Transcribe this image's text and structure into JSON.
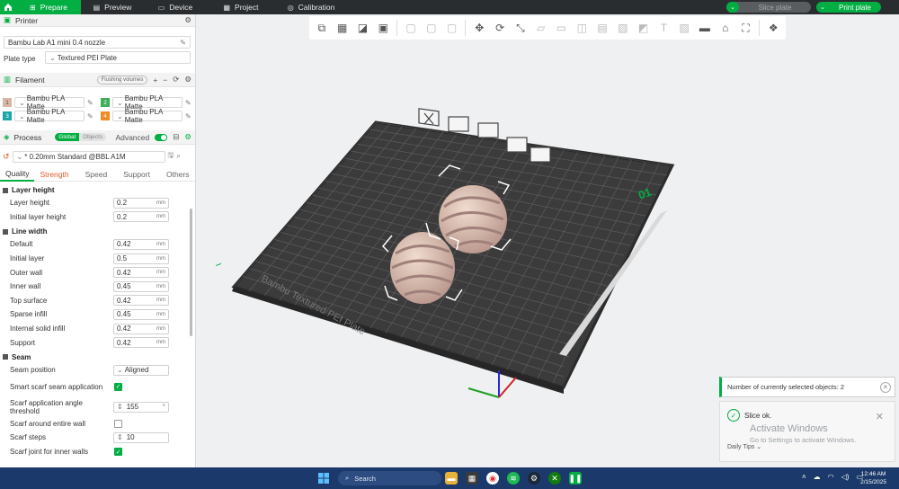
{
  "topbar": {
    "tabs": [
      {
        "label": "Prepare",
        "icon": "prepare-icon"
      },
      {
        "label": "Preview",
        "icon": "preview-icon"
      },
      {
        "label": "Device",
        "icon": "device-icon"
      },
      {
        "label": "Project",
        "icon": "project-icon"
      },
      {
        "label": "Calibration",
        "icon": "calibration-icon"
      }
    ],
    "slice_label": "Slice plate",
    "print_label": "Print plate",
    "accent": "#00ae42"
  },
  "printer": {
    "title": "Printer",
    "name": "Bambu Lab A1 mini 0.4 nozzle",
    "plate_type_label": "Plate type",
    "plate_type": "Textured PEI Plate"
  },
  "filament": {
    "title": "Filament",
    "flushing_label": "Flushing volumes",
    "items": [
      {
        "num": "1",
        "name": "Bambu PLA Matte",
        "color": "#d9b7a6"
      },
      {
        "num": "2",
        "name": "Bambu PLA Matte",
        "color": "#3fae5a"
      },
      {
        "num": "3",
        "name": "Bambu PLA Matte",
        "color": "#1ba7a7"
      },
      {
        "num": "4",
        "name": "Bambu PLA Matte",
        "color": "#f08a24"
      }
    ]
  },
  "process": {
    "title": "Process",
    "global_label": "Global",
    "objects_label": "Objects",
    "advanced_label": "Advanced",
    "preset": "* 0.20mm Standard @BBL A1M",
    "tabs": [
      "Quality",
      "Strength",
      "Speed",
      "Support",
      "Others"
    ]
  },
  "groups": {
    "layer_height": {
      "title": "Layer height",
      "rows": [
        {
          "label": "Layer height",
          "value": "0.2",
          "unit": "mm"
        },
        {
          "label": "Initial layer height",
          "value": "0.2",
          "unit": "mm"
        }
      ]
    },
    "line_width": {
      "title": "Line width",
      "rows": [
        {
          "label": "Default",
          "value": "0.42",
          "unit": "mm"
        },
        {
          "label": "Initial layer",
          "value": "0.5",
          "unit": "mm"
        },
        {
          "label": "Outer wall",
          "value": "0.42",
          "unit": "mm"
        },
        {
          "label": "Inner wall",
          "value": "0.45",
          "unit": "mm"
        },
        {
          "label": "Top surface",
          "value": "0.42",
          "unit": "mm"
        },
        {
          "label": "Sparse infill",
          "value": "0.45",
          "unit": "mm"
        },
        {
          "label": "Internal solid infill",
          "value": "0.42",
          "unit": "mm"
        },
        {
          "label": "Support",
          "value": "0.42",
          "unit": "mm"
        }
      ]
    },
    "seam": {
      "title": "Seam",
      "seam_position_label": "Seam position",
      "seam_position": "Aligned",
      "smart_scarf_label": "Smart scarf seam application",
      "scarf_angle_label": "Scarf application angle threshold",
      "scarf_angle": "155",
      "scarf_entire_label": "Scarf around entire wall",
      "scarf_steps_label": "Scarf steps",
      "scarf_steps": "10",
      "scarf_inner_label": "Scarf joint for inner walls"
    }
  },
  "plate": {
    "label": "Bambu Textured PEI Plate",
    "number": "01",
    "plate_color": "#3a3a3a",
    "object_color": "#d8b8a5"
  },
  "notifications": {
    "selected_text": "Number of currently selected objects: 2",
    "slice_ok": "Slice ok.",
    "activate_title": "Activate Windows",
    "activate_sub": "Go to Settings to activate Windows.",
    "daily_tips": "Daily Tips"
  },
  "taskbar": {
    "search": "Search",
    "time": "12:46 AM",
    "date": "2/15/2025"
  }
}
